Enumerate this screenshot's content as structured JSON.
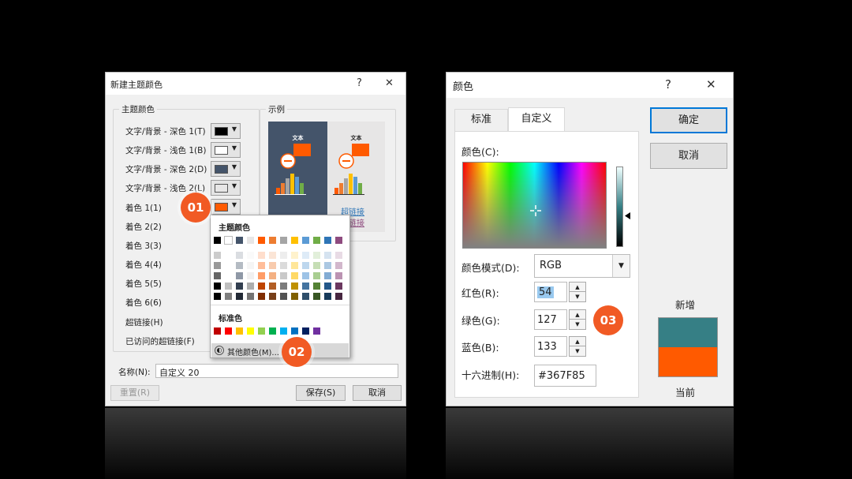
{
  "theme_dialog": {
    "title": "新建主题颜色",
    "help": "?",
    "close": "✕",
    "group_theme": "主题颜色",
    "group_sample": "示例",
    "rows": [
      {
        "label": "文字/背景 - 深色 1(T)",
        "color": "#000000"
      },
      {
        "label": "文字/背景 - 浅色 1(B)",
        "color": "#ffffff"
      },
      {
        "label": "文字/背景 - 深色 2(D)",
        "color": "#44546a"
      },
      {
        "label": "文字/背景 - 浅色 2(L)",
        "color": "#e7e6e6"
      },
      {
        "label": "着色 1(1)",
        "color": "#ff5a00"
      },
      {
        "label": "着色 2(2)"
      },
      {
        "label": "着色 3(3)"
      },
      {
        "label": "着色 4(4)"
      },
      {
        "label": "着色 5(5)"
      },
      {
        "label": "着色 6(6)"
      },
      {
        "label": "超链接(H)"
      },
      {
        "label": "已访问的超链接(F)"
      }
    ],
    "sample_text": "文本",
    "sample_link": "超链接",
    "sample_visited": "超链接",
    "name_label": "名称(N):",
    "name_value": "自定义 20",
    "reset": "重置(R)",
    "save": "保存(S)",
    "cancel": "取消"
  },
  "popup": {
    "theme_header": "主题颜色",
    "theme_colors": [
      "#000000",
      "#ffffff",
      "#44546a",
      "#e7e6e6",
      "#ff5a00",
      "#ed7d31",
      "#a5a5a5",
      "#ffc000",
      "#5b9bd5",
      "#70ad47",
      "#2e75b6",
      "#8e4b7f"
    ],
    "standard_header": "标准色",
    "standard_colors": [
      "#c00000",
      "#ff0000",
      "#ffc000",
      "#ffff00",
      "#92d050",
      "#00b050",
      "#00b0f0",
      "#0070c0",
      "#002060",
      "#7030a0"
    ],
    "more_colors": "其他颜色(M)..."
  },
  "color_dialog": {
    "title": "颜色",
    "help": "?",
    "close": "✕",
    "tab_standard": "标准",
    "tab_custom": "自定义",
    "colors_label": "颜色(C):",
    "mode_label": "颜色模式(D):",
    "mode_value": "RGB",
    "red_label": "红色(R):",
    "red_value": "54",
    "green_label": "绿色(G):",
    "green_value": "127",
    "blue_label": "蓝色(B):",
    "blue_value": "133",
    "hex_label": "十六进制(H):",
    "hex_value": "#367F85",
    "ok": "确定",
    "cancel": "取消",
    "new_label": "新增",
    "current_label": "当前",
    "new_color": "#367f85",
    "current_color": "#ff5a00"
  },
  "badges": {
    "step1": "01",
    "step2": "02",
    "step3": "03"
  }
}
